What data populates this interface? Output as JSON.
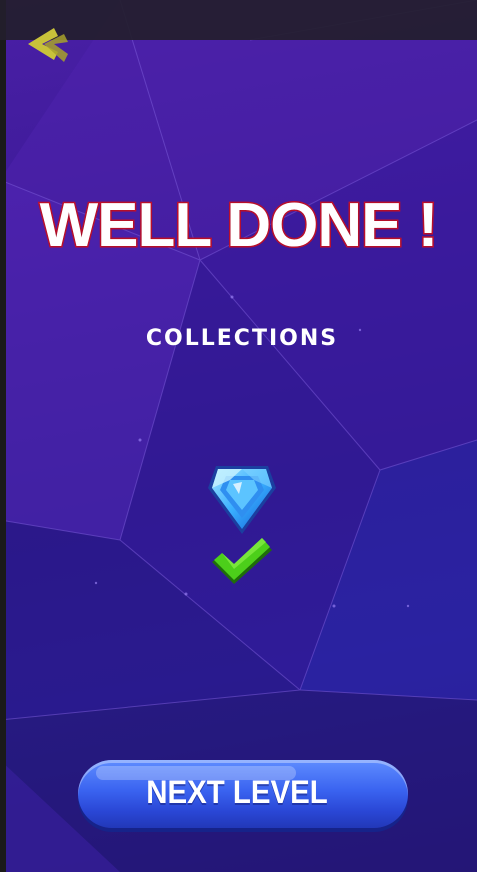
{
  "title": "WELL DONE !",
  "subtitle": "COLLECTIONS",
  "next_button": {
    "label": "NEXT LEVEL"
  },
  "icons": {
    "back": "back-arrow-icon",
    "gem": "diamond-gem-icon",
    "check": "checkmark-icon"
  },
  "colors": {
    "background": "#3a1a96",
    "title_fill": "#ffffff",
    "title_stroke": "#c8102e",
    "button": "#3a63f0",
    "check": "#4ccf1a",
    "gem": "#3ab0ff",
    "back_arrow": "#c8c23a"
  }
}
